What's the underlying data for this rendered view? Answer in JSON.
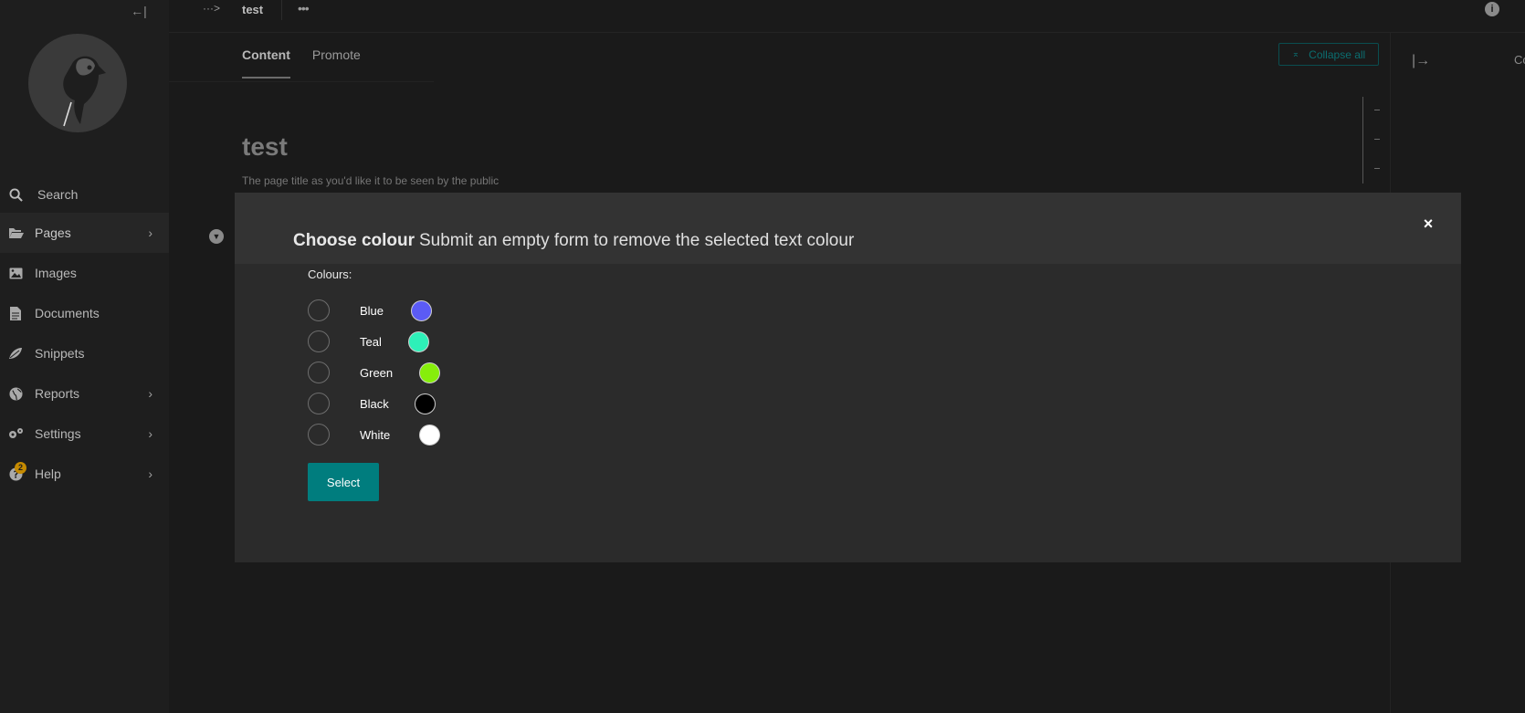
{
  "sidebar": {
    "collapse_icon": "←|",
    "items": [
      {
        "label": "Search",
        "icon": "search-icon"
      },
      {
        "label": "Pages",
        "icon": "folder-open-icon"
      },
      {
        "label": "Images",
        "icon": "image-icon"
      },
      {
        "label": "Documents",
        "icon": "document-icon"
      },
      {
        "label": "Snippets",
        "icon": "snippet-icon"
      },
      {
        "label": "Reports",
        "icon": "globe-icon"
      },
      {
        "label": "Settings",
        "icon": "cogs-icon"
      },
      {
        "label": "Help",
        "icon": "help-icon",
        "badge": "2"
      }
    ]
  },
  "header": {
    "breadcrumb_dots": "···>",
    "title": "test",
    "more": "•••",
    "info": "i"
  },
  "tabs": [
    {
      "label": "Content",
      "active": true
    },
    {
      "label": "Promote",
      "active": false
    }
  ],
  "toolbar": {
    "collapse_all": "Collapse all"
  },
  "page": {
    "heading": "test",
    "help_text": "The page title as you'd like it to be seen by the public"
  },
  "right_panel": {
    "label": "Co"
  },
  "modal": {
    "title": "Choose colour",
    "subtitle": "Submit an empty form to remove the selected text colour",
    "close": "×",
    "colours_label": "Colours:",
    "options": [
      {
        "label": "Blue",
        "color": "#5b5bf5"
      },
      {
        "label": "Teal",
        "color": "#2ef0b8"
      },
      {
        "label": "Green",
        "color": "#86ee0b"
      },
      {
        "label": "Black",
        "color": "#000000"
      },
      {
        "label": "White",
        "color": "#ffffff"
      }
    ],
    "select_label": "Select"
  },
  "colors": {
    "accent": "#007d7e",
    "modal_bg": "#2b2b2b",
    "modal_header_bg": "#333333",
    "sidebar_bg": "#1e1e1e",
    "page_bg": "#1a1a1a"
  }
}
